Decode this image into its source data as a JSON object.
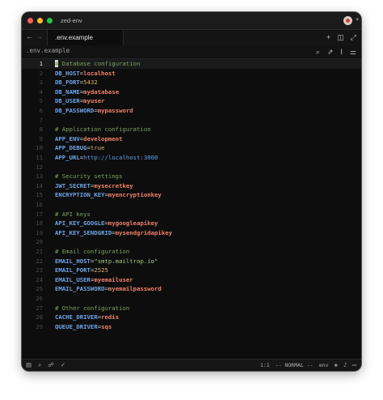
{
  "window": {
    "project_name": "zed-env",
    "colors": {
      "close": "#ff5f57",
      "minimize": "#febc2e",
      "zoom": "#28c840"
    }
  },
  "tabbar": {
    "back_icon": "arrow-left-icon",
    "forward_icon": "arrow-right-icon",
    "active_tab": ".env.example",
    "right_icons": [
      "plus-icon",
      "split-pane-icon",
      "expand-icon"
    ]
  },
  "breadcrumb": {
    "path": ".env.example",
    "tools": [
      "search-icon",
      "magic-wand-icon",
      "text-cursor-icon",
      "settings-sliders-icon"
    ]
  },
  "editor": {
    "active_line": 1,
    "lines": [
      {
        "n": "1",
        "tokens": [
          {
            "t": "#",
            "c": "cursor"
          },
          {
            "t": " Database configuration",
            "c": "comment"
          }
        ]
      },
      {
        "n": "2",
        "tokens": [
          {
            "t": "DB_HOST",
            "c": "key"
          },
          {
            "t": "=",
            "c": "eq"
          },
          {
            "t": "localhost",
            "c": "val"
          }
        ]
      },
      {
        "n": "3",
        "tokens": [
          {
            "t": "DB_PORT",
            "c": "key"
          },
          {
            "t": "=",
            "c": "eq"
          },
          {
            "t": "5432",
            "c": "num"
          }
        ]
      },
      {
        "n": "4",
        "tokens": [
          {
            "t": "DB_NAME",
            "c": "key"
          },
          {
            "t": "=",
            "c": "eq"
          },
          {
            "t": "mydatabase",
            "c": "val"
          }
        ]
      },
      {
        "n": "5",
        "tokens": [
          {
            "t": "DB_USER",
            "c": "key"
          },
          {
            "t": "=",
            "c": "eq"
          },
          {
            "t": "myuser",
            "c": "val"
          }
        ]
      },
      {
        "n": "6",
        "tokens": [
          {
            "t": "DB_PASSWORD",
            "c": "key"
          },
          {
            "t": "=",
            "c": "eq"
          },
          {
            "t": "mypassword",
            "c": "val"
          }
        ]
      },
      {
        "n": "7",
        "tokens": []
      },
      {
        "n": "8",
        "tokens": [
          {
            "t": "# Application configuration",
            "c": "comment"
          }
        ]
      },
      {
        "n": "9",
        "tokens": [
          {
            "t": "APP_ENV",
            "c": "key"
          },
          {
            "t": "=",
            "c": "eq"
          },
          {
            "t": "development",
            "c": "val"
          }
        ]
      },
      {
        "n": "10",
        "tokens": [
          {
            "t": "APP_DEBUG",
            "c": "key"
          },
          {
            "t": "=",
            "c": "eq"
          },
          {
            "t": "true",
            "c": "num"
          }
        ]
      },
      {
        "n": "11",
        "tokens": [
          {
            "t": "APP_URL",
            "c": "key"
          },
          {
            "t": "=",
            "c": "eq"
          },
          {
            "t": "http://localhost:3000",
            "c": "url"
          }
        ]
      },
      {
        "n": "12",
        "tokens": []
      },
      {
        "n": "13",
        "tokens": [
          {
            "t": "# Security settings",
            "c": "comment"
          }
        ]
      },
      {
        "n": "14",
        "tokens": [
          {
            "t": "JWT_SECRET",
            "c": "key"
          },
          {
            "t": "=",
            "c": "eq"
          },
          {
            "t": "mysecretkey",
            "c": "val"
          }
        ]
      },
      {
        "n": "15",
        "tokens": [
          {
            "t": "ENCRYPTION_KEY",
            "c": "key"
          },
          {
            "t": "=",
            "c": "eq"
          },
          {
            "t": "myencryptionkey",
            "c": "val"
          }
        ]
      },
      {
        "n": "16",
        "tokens": []
      },
      {
        "n": "17",
        "tokens": [
          {
            "t": "# API keys",
            "c": "comment"
          }
        ]
      },
      {
        "n": "18",
        "tokens": [
          {
            "t": "API_KEY_GOOGLE",
            "c": "key"
          },
          {
            "t": "=",
            "c": "eq"
          },
          {
            "t": "mygoogleapikey",
            "c": "val"
          }
        ]
      },
      {
        "n": "19",
        "tokens": [
          {
            "t": "API_KEY_SENDGRID",
            "c": "key"
          },
          {
            "t": "=",
            "c": "eq"
          },
          {
            "t": "mysendgridapikey",
            "c": "val"
          }
        ]
      },
      {
        "n": "20",
        "tokens": []
      },
      {
        "n": "21",
        "tokens": [
          {
            "t": "# Email configuration",
            "c": "comment"
          }
        ]
      },
      {
        "n": "22",
        "tokens": [
          {
            "t": "EMAIL_HOST",
            "c": "key"
          },
          {
            "t": "=",
            "c": "eq"
          },
          {
            "t": "\"smtp.mailtrap.io\"",
            "c": "str"
          }
        ]
      },
      {
        "n": "23",
        "tokens": [
          {
            "t": "EMAIL_PORT",
            "c": "key"
          },
          {
            "t": "=",
            "c": "eq"
          },
          {
            "t": "2525",
            "c": "num"
          }
        ]
      },
      {
        "n": "24",
        "tokens": [
          {
            "t": "EMAIL_USER",
            "c": "key"
          },
          {
            "t": "=",
            "c": "eq"
          },
          {
            "t": "myemailuser",
            "c": "val"
          }
        ]
      },
      {
        "n": "25",
        "tokens": [
          {
            "t": "EMAIL_PASSWORD",
            "c": "key"
          },
          {
            "t": "=",
            "c": "eq"
          },
          {
            "t": "myemailpassword",
            "c": "val"
          }
        ]
      },
      {
        "n": "26",
        "tokens": []
      },
      {
        "n": "27",
        "tokens": [
          {
            "t": "# Other configuration",
            "c": "comment"
          }
        ]
      },
      {
        "n": "28",
        "tokens": [
          {
            "t": "CACHE_DRIVER",
            "c": "key"
          },
          {
            "t": "=",
            "c": "eq"
          },
          {
            "t": "redis",
            "c": "val"
          }
        ]
      },
      {
        "n": "29",
        "tokens": [
          {
            "t": "QUEUE_DRIVER",
            "c": "key"
          },
          {
            "t": "=",
            "c": "eq"
          },
          {
            "t": "sqs",
            "c": "val"
          }
        ]
      }
    ]
  },
  "statusbar": {
    "left_icons": [
      "panel-icon",
      "search-icon",
      "collaborators-icon",
      "check-icon"
    ],
    "cursor_position": "1:1",
    "vim_mode": "-- NORMAL --",
    "language": "env",
    "right_icons": [
      "assistant-icon",
      "bell-icon",
      "chat-icon"
    ]
  }
}
